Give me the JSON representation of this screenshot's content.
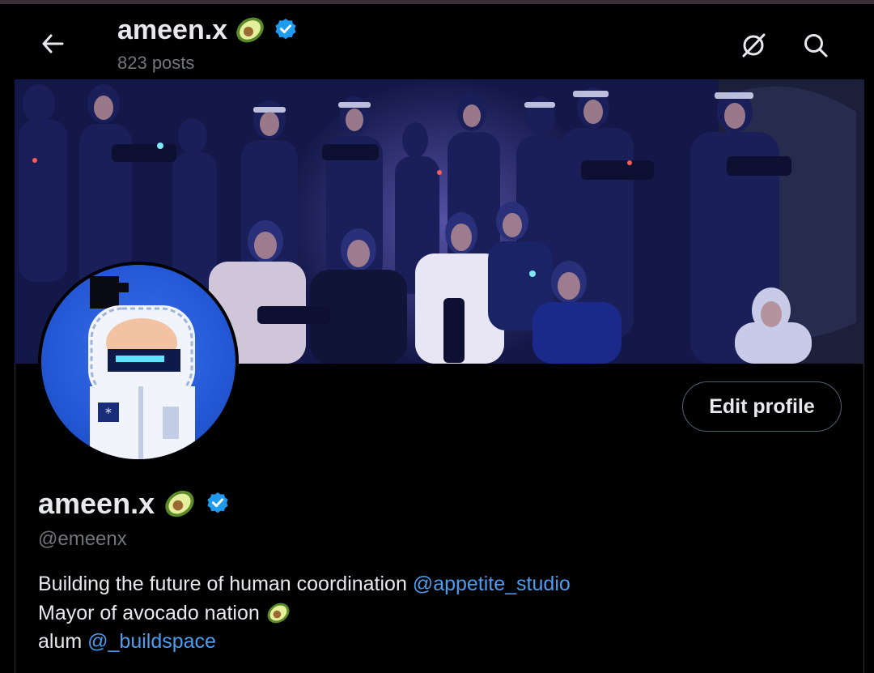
{
  "header": {
    "display_name": "ameen.x",
    "posts_count": "823 posts"
  },
  "profile": {
    "display_name": "ameen.x",
    "handle": "@emeenx",
    "edit_button_label": "Edit profile",
    "bio": {
      "line1_text": "Building the future of human coordination ",
      "line1_mention": "@appetite_studio",
      "line2_text": "Mayor of avocado nation ",
      "line3_text": "alum ",
      "line3_mention": "@_buildspace"
    }
  },
  "icons": {
    "back": "arrow-left-icon",
    "grok": "grok-icon",
    "search": "search-icon",
    "verified": "verified-badge-icon",
    "emoji": "avocado-emoji-icon"
  },
  "colors": {
    "background": "#000000",
    "accent_link": "#4a9df0",
    "verified_blue": "#1d9bf0",
    "secondary_text": "#71767b"
  }
}
